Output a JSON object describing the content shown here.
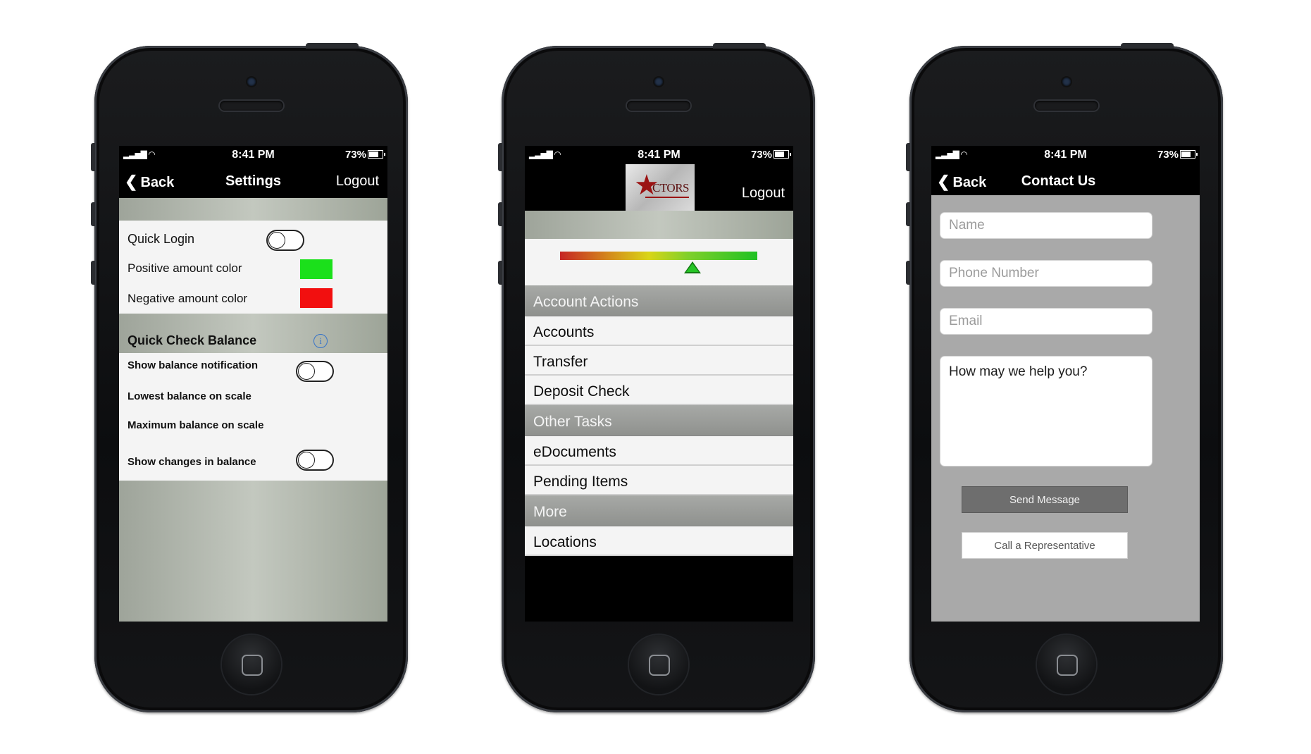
{
  "status": {
    "time": "8:41 PM",
    "battery": "73%"
  },
  "settings": {
    "back_label": "Back",
    "title": "Settings",
    "logout_label": "Logout",
    "quick_login_label": "Quick Login",
    "positive_color_label": "Positive amount color",
    "positive_color": "#1be01b",
    "negative_color_label": "Negative amount color",
    "negative_color": "#f20f0f",
    "section_title": "Quick Check Balance",
    "show_notification_label": "Show balance notification",
    "lowest_balance_label": "Lowest balance on scale",
    "maximum_balance_label": "Maximum balance on scale",
    "show_changes_label": "Show changes in balance"
  },
  "menu": {
    "logo_text": "CTORS",
    "logout_label": "Logout",
    "balance_indicator_level": 0.67,
    "sections": [
      {
        "header": "Account Actions",
        "items": [
          "Accounts",
          "Transfer",
          "Deposit Check"
        ]
      },
      {
        "header": "Other Tasks",
        "items": [
          "eDocuments",
          "Pending Items"
        ]
      },
      {
        "header": "More",
        "items": [
          "Locations"
        ]
      }
    ]
  },
  "contact": {
    "back_label": "Back",
    "title": "Contact Us",
    "name_placeholder": "Name",
    "phone_placeholder": "Phone Number",
    "email_placeholder": "Email",
    "message_placeholder": "How may we help you?",
    "send_label": "Send Message",
    "call_label": "Call a Representative"
  }
}
